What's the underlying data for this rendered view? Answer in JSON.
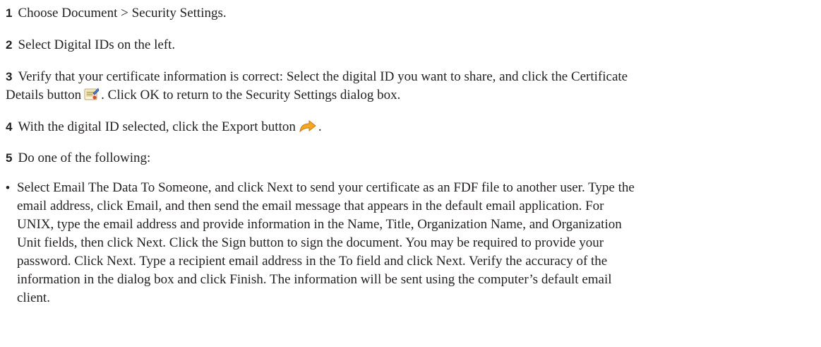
{
  "steps": [
    {
      "number": "1",
      "text": "Choose Document > Security Settings."
    },
    {
      "number": "2",
      "text": "Select Digital IDs on the left."
    },
    {
      "number": "3",
      "line1": "Verify that your certificate information is correct: Select the digital ID you want to share, and click the Certificate",
      "line2_pre": "Details button",
      "line2_post": ". Click OK to return to the Security Settings dialog box.",
      "icon": "certificate-details-icon"
    },
    {
      "number": "4",
      "text_pre": "With the digital ID selected, click the Export button",
      "text_post": ".",
      "icon": "export-arrow-icon"
    },
    {
      "number": "5",
      "text": "Do one of the following:"
    }
  ],
  "bullet": {
    "symbol": "•",
    "lines": [
      "Select Email The Data To Someone, and click Next to send your certificate as an FDF file to another user. Type the",
      "email address, click Email, and then send the email message that appears in the default email application. For",
      "UNIX, type the email address and provide information in the Name, Title, Organization Name, and Organization",
      "Unit fields, then click Next. Click the Sign button to sign the document. You may be required to provide your",
      "password. Click Next. Type a recipient email address in the To field and click Next. Verify the accuracy of the",
      "information in the dialog box and click Finish. The information will be sent using the computer’s default email",
      "client."
    ]
  },
  "colors": {
    "text": "#231f20",
    "step_number": "#231f20",
    "export_arrow": "#f5a623"
  }
}
